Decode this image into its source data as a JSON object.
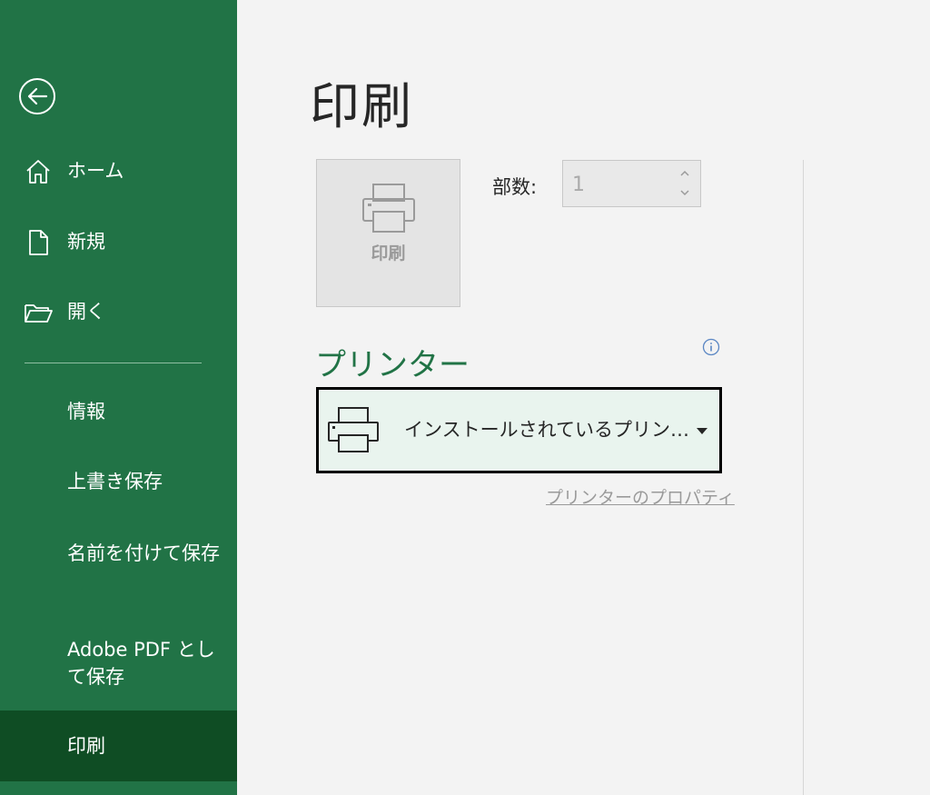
{
  "nav": {
    "items": [
      {
        "label": "ホーム",
        "icon": "home-icon"
      },
      {
        "label": "新規",
        "icon": "new-document-icon"
      },
      {
        "label": "開く",
        "icon": "open-folder-icon"
      }
    ],
    "sub_items": [
      {
        "label": "情報"
      },
      {
        "label": "上書き保存"
      },
      {
        "label": "名前を付けて保存"
      },
      {
        "label": "Adobe PDF として保存"
      },
      {
        "label": "印刷",
        "active": true
      }
    ]
  },
  "main": {
    "title": "印刷",
    "print_button_label": "印刷",
    "copies_label": "部数:",
    "copies_value": "1",
    "printer_heading": "プリンター",
    "printer_name": "インストールされているプリン…",
    "printer_properties_link": "プリンターのプロパティ"
  },
  "colors": {
    "sidebar": "#217346",
    "active_item": "#0f4d24",
    "accent": "#217346",
    "background": "#f3f3f3"
  }
}
